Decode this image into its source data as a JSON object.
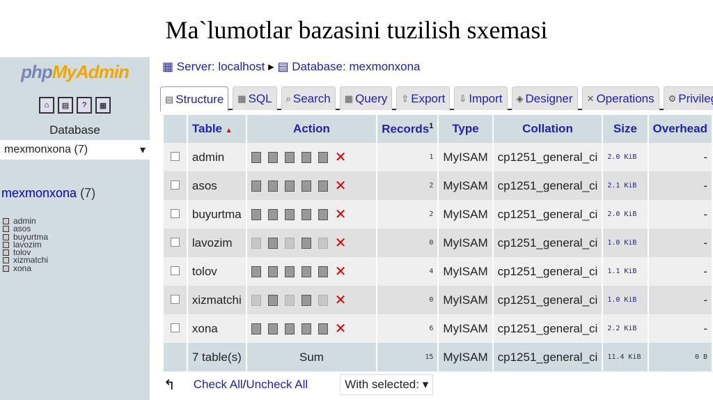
{
  "slide_title": "Ma`lumotlar bazasini tuzilish sxemasi",
  "sidebar": {
    "logo_php": "php",
    "logo_my": "MyAdmin",
    "database_label": "Database",
    "database_select": "mexmonxona (7)",
    "db_link": "mexmonxona",
    "db_count": "(7)",
    "tables": [
      "admin",
      "asos",
      "buyurtma",
      "lavozim",
      "tolov",
      "xizmatchi",
      "xona"
    ]
  },
  "breadcrumb": {
    "server": "Server: localhost",
    "database": "Database: mexmonxona"
  },
  "tabs": [
    "Structure",
    "SQL",
    "Search",
    "Query",
    "Export",
    "Import",
    "Designer",
    "Operations",
    "Privileges"
  ],
  "columns": {
    "table": "Table",
    "action": "Action",
    "records": "Records",
    "records_sup": "1",
    "type": "Type",
    "collation": "Collation",
    "size": "Size",
    "overhead": "Overhead"
  },
  "rows": [
    {
      "name": "admin",
      "records": "1",
      "type": "MyISAM",
      "collation": "cp1251_general_ci",
      "size": "2.0 KiB",
      "overhead": "-",
      "empty": false
    },
    {
      "name": "asos",
      "records": "2",
      "type": "MyISAM",
      "collation": "cp1251_general_ci",
      "size": "2.1 KiB",
      "overhead": "-",
      "empty": false
    },
    {
      "name": "buyurtma",
      "records": "2",
      "type": "MyISAM",
      "collation": "cp1251_general_ci",
      "size": "2.0 KiB",
      "overhead": "-",
      "empty": false
    },
    {
      "name": "lavozim",
      "records": "0",
      "type": "MyISAM",
      "collation": "cp1251_general_ci",
      "size": "1.0 KiB",
      "overhead": "-",
      "empty": true
    },
    {
      "name": "tolov",
      "records": "4",
      "type": "MyISAM",
      "collation": "cp1251_general_ci",
      "size": "1.1 KiB",
      "overhead": "-",
      "empty": false
    },
    {
      "name": "xizmatchi",
      "records": "0",
      "type": "MyISAM",
      "collation": "cp1251_general_ci",
      "size": "1.0 KiB",
      "overhead": "-",
      "empty": true
    },
    {
      "name": "xona",
      "records": "6",
      "type": "MyISAM",
      "collation": "cp1251_general_ci",
      "size": "2.2 KiB",
      "overhead": "-",
      "empty": false
    }
  ],
  "footer": {
    "tables": "7 table(s)",
    "sum": "Sum",
    "records": "15",
    "type": "MyISAM",
    "collation": "cp1251_general_ci",
    "size": "11.4 KiB",
    "overhead": "0 B"
  },
  "bottom": {
    "check_all": "Check All",
    "separator": " / ",
    "uncheck_all": "Uncheck All",
    "with_selected": "With selected:"
  }
}
